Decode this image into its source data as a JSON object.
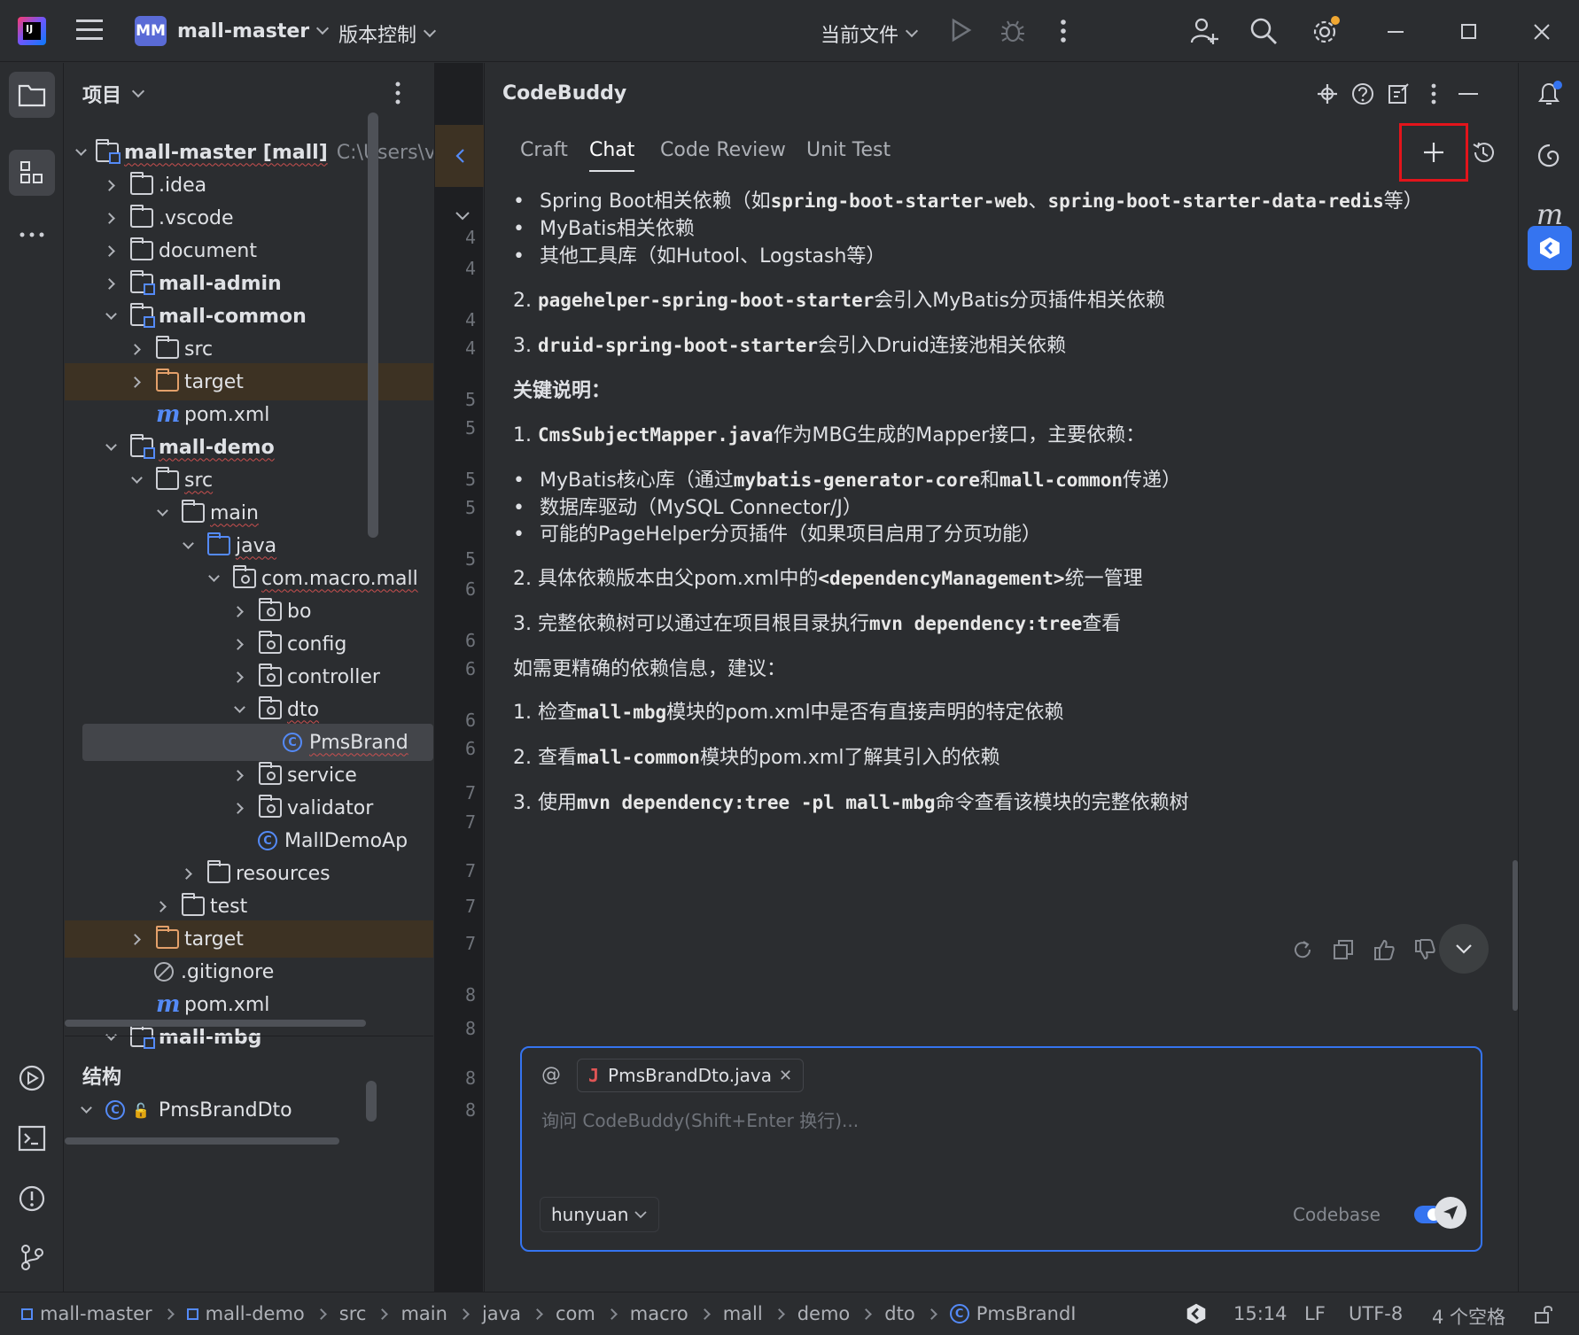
{
  "titlebar": {
    "project_badge": "MM",
    "project_name": "mall-master",
    "vcs_label": "版本控制",
    "run_config": "当前文件"
  },
  "project_panel": {
    "title": "项目",
    "root_name": "mall-master [mall]",
    "root_path": "C:\\Users\\v_n",
    "items": {
      "idea": ".idea",
      "vscode": ".vscode",
      "document": "document",
      "mall_admin": "mall-admin",
      "mall_common": "mall-common",
      "common_src": "src",
      "common_target": "target",
      "common_pom": "pom.xml",
      "mall_demo": "mall-demo",
      "demo_src": "src",
      "main": "main",
      "java": "java",
      "package": "com.macro.mall",
      "bo": "bo",
      "config": "config",
      "controller": "controller",
      "dto": "dto",
      "pms_brand": "PmsBrand",
      "service": "service",
      "validator": "validator",
      "mall_demo_app": "MallDemoAp",
      "resources": "resources",
      "test": "test",
      "demo_target": "target",
      "gitignore": ".gitignore",
      "demo_pom": "pom.xml",
      "mall_mbg": "mall-mbg"
    },
    "structure_title": "结构",
    "structure_item": "PmsBrandDto"
  },
  "gutter_numbers": [
    "4",
    "4",
    "4",
    "4",
    "5",
    "5",
    "5",
    "5",
    "5",
    "6",
    "6",
    "6",
    "6",
    "6",
    "7",
    "7",
    "7",
    "7",
    "7",
    "8",
    "8",
    "8",
    "8"
  ],
  "codebuddy": {
    "title": "CodeBuddy",
    "tabs": [
      "Craft",
      "Chat",
      "Code Review",
      "Unit Test"
    ],
    "active_tab": "Chat",
    "content": {
      "b1_pre": "Spring Boot相关依赖（如",
      "b1_c1": "spring-boot-starter-web",
      "b1_mid": "、",
      "b1_c2": "spring-boot-starter-data-redis",
      "b1_post": "等）",
      "b2": "MyBatis相关依赖",
      "b3": "其他工具库（如Hutool、Logstash等）",
      "p2_pre": "2. ",
      "p2_code": "pagehelper-spring-boot-starter",
      "p2_post": "会引入MyBatis分页插件相关依赖",
      "p3_pre": "3. ",
      "p3_code": "druid-spring-boot-starter",
      "p3_post": "会引入Druid连接池相关依赖",
      "key_heading": "关键说明：",
      "k1_pre": "1. ",
      "k1_code": "CmsSubjectMapper.java",
      "k1_post": "作为MBG生成的Mapper接口，主要依赖：",
      "kb1_pre": "MyBatis核心库（通过",
      "kb1_c1": "mybatis-generator-core",
      "kb1_mid": "和",
      "kb1_c2": "mall-common",
      "kb1_post": "传递）",
      "kb2": "数据库驱动（MySQL Connector/J）",
      "kb3": "可能的PageHelper分页插件（如果项目启用了分页功能）",
      "k2_pre": "2. 具体依赖版本由父pom.xml中的",
      "k2_code": "<dependencyManagement>",
      "k2_post": "统一管理",
      "k3_pre": "3. 完整依赖树可以通过在项目根目录执行",
      "k3_code": "mvn dependency:tree",
      "k3_post": "查看",
      "suggest": "如需更精确的依赖信息，建议：",
      "s1_pre": "1. 检查",
      "s1_code": "mall-mbg",
      "s1_post": "模块的pom.xml中是否有直接声明的特定依赖",
      "s2_pre": "2. 查看",
      "s2_code": "mall-common",
      "s2_post": "模块的pom.xml了解其引入的依赖",
      "s3_pre": "3. 使用",
      "s3_code": "mvn dependency:tree -pl mall-mbg",
      "s3_post": "命令查看该模块的完整依赖树"
    },
    "input": {
      "at": "@",
      "context_file": "PmsBrandDto.java",
      "placeholder": "询问 CodeBuddy(Shift+Enter 换行)...",
      "model": "hunyuan",
      "codebase_label": "Codebase"
    }
  },
  "statusbar": {
    "breadcrumbs": [
      "mall-master",
      "mall-demo",
      "src",
      "main",
      "java",
      "com",
      "macro",
      "mall",
      "demo",
      "dto",
      "PmsBrandI"
    ],
    "position": "15:14",
    "line_sep": "LF",
    "encoding": "UTF-8",
    "indent": "4 个空格"
  },
  "colors": {
    "accent": "#3574f0",
    "highlight_box": "#e3141b",
    "background": "#2b2d30"
  }
}
